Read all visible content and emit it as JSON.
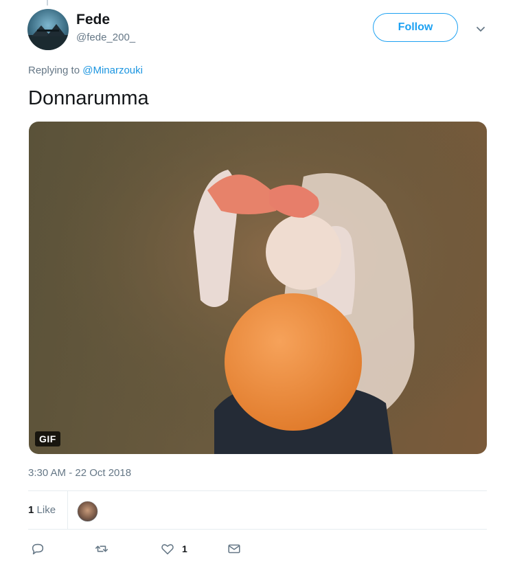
{
  "user": {
    "display_name": "Fede",
    "handle": "@fede_200_",
    "avatar_icon": "user-avatar"
  },
  "follow_label": "Follow",
  "reply": {
    "prefix": "Replying to ",
    "mention": "@Minarzouki"
  },
  "tweet_text": "Donnarumma",
  "media": {
    "badge": "GIF"
  },
  "timestamp": "3:30 AM - 22 Oct 2018",
  "stats": {
    "likes_count": "1",
    "likes_label": "Like"
  },
  "actions": {
    "like_count": "1"
  },
  "colors": {
    "accent": "#1da1f2",
    "muted": "#657786",
    "text": "#14171a",
    "border": "#e6ecf0"
  }
}
